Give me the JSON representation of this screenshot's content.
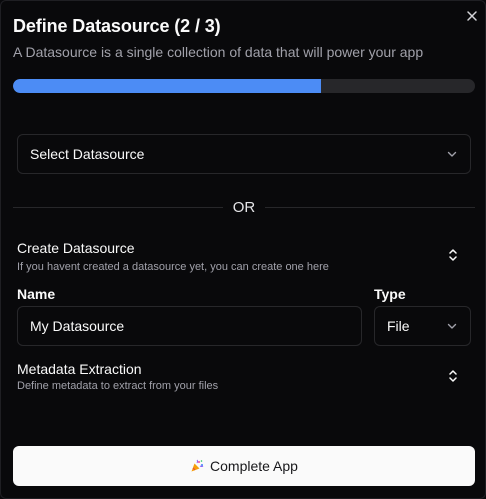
{
  "dialog": {
    "title": "Define Datasource (2 / 3)",
    "subtitle": "A Datasource is a single collection of data that will power your app",
    "progress_fraction": 0.667,
    "close_icon": "close-icon"
  },
  "datasource_select": {
    "label": "Select Datasource",
    "icon": "chevron-down-icon"
  },
  "divider": {
    "or_text": "OR"
  },
  "create_section": {
    "title": "Create Datasource",
    "description": "If you havent created a datasource yet, you can create one here",
    "toggle_icon": "chevrons-up-down-icon"
  },
  "form": {
    "name_label": "Name",
    "name_value": "My Datasource",
    "type_label": "Type",
    "type_value": "File"
  },
  "metadata_section": {
    "title": "Metadata Extraction",
    "description": "Define metadata to extract from your files",
    "toggle_icon": "chevrons-up-down-icon"
  },
  "actions": {
    "complete_label": "Complete App",
    "complete_icon": "party-popper-icon"
  },
  "colors": {
    "background": "#09090b",
    "accent": "#4c8cf5",
    "border": "#27272a",
    "button_bg": "#fafafa"
  }
}
